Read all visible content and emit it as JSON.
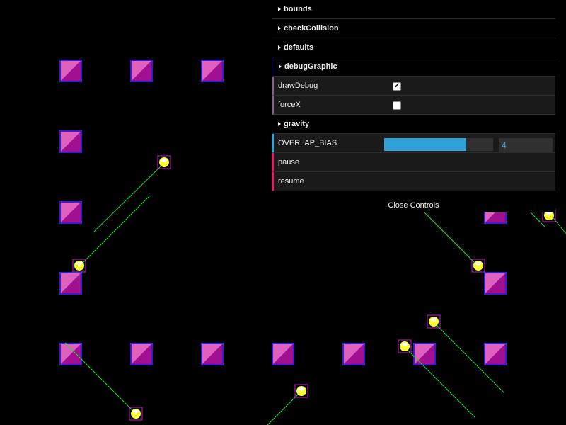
{
  "gui": {
    "folders_top": [
      {
        "label": "bounds"
      },
      {
        "label": "checkCollision"
      },
      {
        "label": "defaults"
      },
      {
        "label": "debugGraphic"
      }
    ],
    "draw_debug": {
      "label": "drawDebug",
      "checked": true
    },
    "force_x": {
      "label": "forceX",
      "checked": false
    },
    "gravity": {
      "label": "gravity"
    },
    "overlap_bias": {
      "label": "OVERLAP_BIAS",
      "value": "4",
      "fraction": 0.75
    },
    "pause": {
      "label": "pause"
    },
    "resume": {
      "label": "resume"
    },
    "close_label": "Close Controls"
  },
  "colors": {
    "block_light": "#e060c0",
    "block_dark": "#a01090",
    "block_border": "#3a1ad0",
    "ball_fill": "#ffff30",
    "ball_highlight": "#ffffff",
    "ball_box": "#c020c0",
    "velocity_line": "#22dd22",
    "slider": "#2fa1d6",
    "func_border": "#e61d5f",
    "bool_border": "#806787"
  },
  "icons": {
    "folder": "triangle-right",
    "check": "checkmark"
  }
}
